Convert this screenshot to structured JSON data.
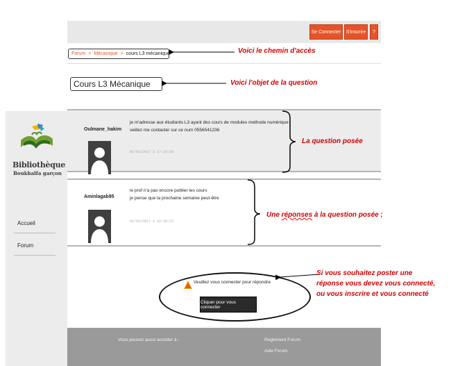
{
  "header": {
    "login_label": "Se Connecter",
    "register_label": "S'inscrire",
    "help_label": "?"
  },
  "sidebar": {
    "logo_title": "Bibliothèque",
    "logo_subtitle": "Boukhalfa garçon",
    "items": [
      {
        "label": "Accueil"
      },
      {
        "label": "Forum"
      }
    ]
  },
  "breadcrumb": {
    "items": [
      "Forum",
      "Mécanique",
      "cours L3 mécanique"
    ]
  },
  "question": {
    "title": "Cours L3 Mécanique"
  },
  "posts": [
    {
      "author": "Oulmane_hakim",
      "lines": [
        "je m'adresse aux étudiants L3 ayant des cours de modules methode numérique",
        "veillez me contacter sur ce num 0556541236"
      ],
      "date": "01/03/2017 à 17:16:58"
    },
    {
      "author": "Aminlagab95",
      "lines": [
        "le prof n'a pas encore publier les cours",
        "je pense que la prochaine semaine peut-être"
      ],
      "date": "01/03/2017 à 18:38:22"
    }
  ],
  "login_prompt": {
    "message": "Veuillez vous connecter pour répondre",
    "button_label": "Cliquer pour vous connecter"
  },
  "footer": {
    "access_label": "Vous pouvez aussi accéder à :",
    "links": [
      "Reglement Forum",
      "Aide Forum"
    ]
  },
  "annotations": {
    "breadcrumb_note": "Voici le chemin  d'accès",
    "title_note": "Voici l'objet de la question",
    "question_note": "La question posée",
    "reply_note_prefix": "Une ",
    "reply_note_underlined": "réponses",
    "reply_note_suffix": " à la question posée ;",
    "login_note_lines": [
      "Si vous souhaitez poster une",
      "réponse vous devez vous connecté,",
      "ou vous inscrire et vous connecté"
    ]
  },
  "colors": {
    "accent": "#e4542a",
    "annotation": "#d00000",
    "footer": "#9a9a9a"
  }
}
